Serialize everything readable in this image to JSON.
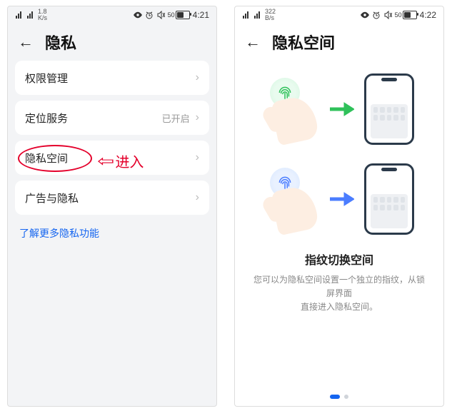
{
  "left": {
    "status": {
      "speed": "1.8",
      "unit": "K/s",
      "time": "4:21",
      "battery": "50"
    },
    "title": "隐私",
    "items": [
      {
        "label": "权限管理",
        "value": ""
      },
      {
        "label": "定位服务",
        "value": "已开启"
      },
      {
        "label": "隐私空间",
        "value": ""
      },
      {
        "label": "广告与隐私",
        "value": ""
      }
    ],
    "more": "了解更多隐私功能",
    "annotation": "进入"
  },
  "right": {
    "status": {
      "speed": "322",
      "unit": "B/s",
      "time": "4:22",
      "battery": "50"
    },
    "title": "隐私空间",
    "info_title": "指纹切换空间",
    "info_desc_l1": "您可以为隐私空间设置一个独立的指纹，从锁屏界面",
    "info_desc_l2": "直接进入隐私空间。"
  }
}
